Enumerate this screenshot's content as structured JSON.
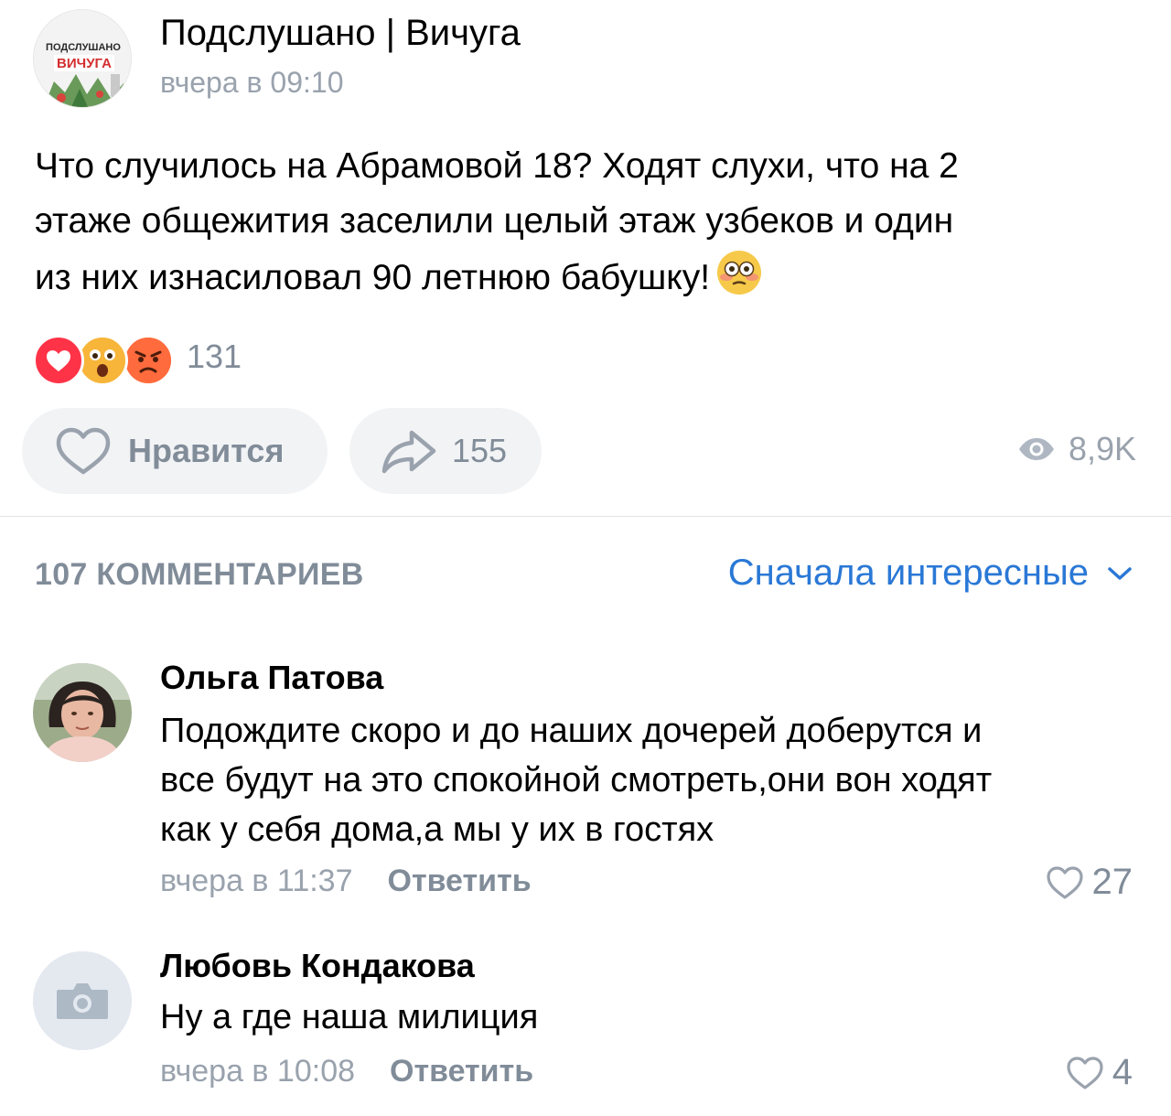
{
  "post": {
    "group_name": "Подслушано | Вичуга",
    "group_avatar": {
      "logo_line1": "ПОДСЛУШАНО",
      "logo_line2": "ВИЧУГА"
    },
    "time": "вчера в 09:10",
    "text_lines": [
      "Что случилось на Абрамовой 18? Ходят слухи, что на 2",
      "этаже общежития заселили целый этаж узбеков и один",
      "из них изнасиловал 90 летнюю бабушку!"
    ],
    "text_emoji": "flushed-face-emoji",
    "reactions": {
      "icons": [
        "heart-reaction",
        "shocked-face-reaction",
        "angry-face-reaction"
      ],
      "count": "131"
    },
    "actions": {
      "like_label": "Нравится",
      "share_count": "155",
      "views": "8,9K"
    }
  },
  "comments_header": {
    "count_label": "107 КОММЕНТАРИЕВ",
    "sort_label": "Сначала интересные"
  },
  "comments": [
    {
      "author": "Ольга Патова",
      "text_lines": [
        "Подождите скоро и до наших дочерей доберутся и",
        "все будут на это спокойной смотреть,они вон ходят",
        "как у себя дома,а мы у их в гостях"
      ],
      "time": "вчера в 11:37",
      "reply_label": "Ответить",
      "likes": "27"
    },
    {
      "author": "Любовь Кондакова",
      "text_lines": [
        "Ну а где наша милиция"
      ],
      "time": "вчера в 10:08",
      "reply_label": "Ответить",
      "likes": "4"
    }
  ],
  "colors": {
    "link_blue": "#2a78d6",
    "secondary_gray": "#818c99",
    "time_gray": "#99a2ad",
    "button_bg": "#f2f3f5",
    "divider": "#e3e4e8"
  }
}
